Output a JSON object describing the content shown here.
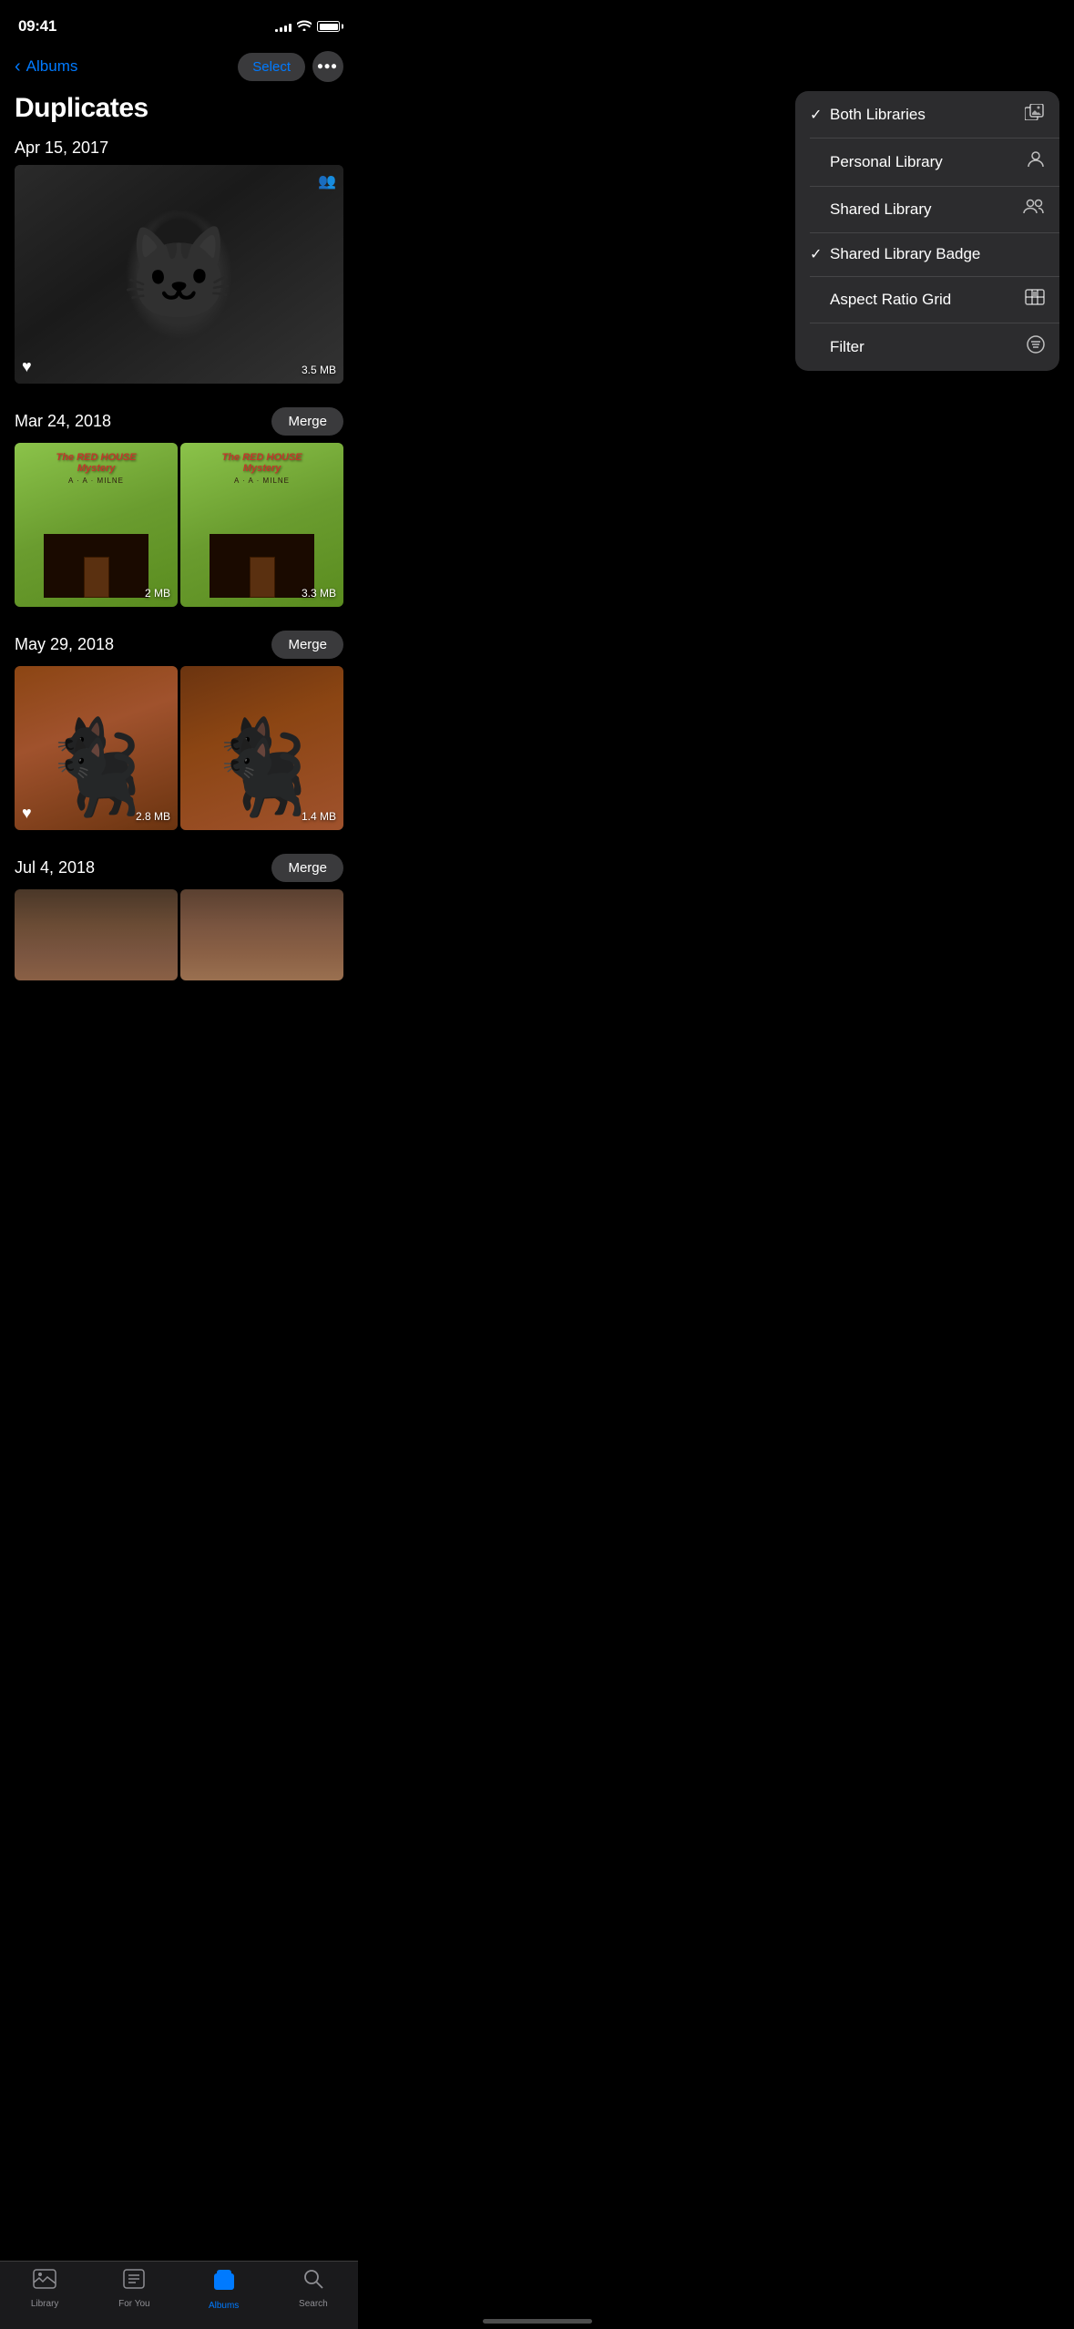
{
  "status": {
    "time": "09:41",
    "signal_bars": [
      3,
      5,
      7,
      9,
      11
    ],
    "wifi": "wifi",
    "battery": "full"
  },
  "header": {
    "back_label": "Albums",
    "title": "Duplicates",
    "select_label": "Select",
    "more_label": "•••"
  },
  "dropdown": {
    "items": [
      {
        "id": "both-libraries",
        "label": "Both Libraries",
        "checked": true,
        "icon": "gallery"
      },
      {
        "id": "personal-library",
        "label": "Personal Library",
        "checked": false,
        "icon": "person"
      },
      {
        "id": "shared-library",
        "label": "Shared Library",
        "checked": false,
        "icon": "people"
      },
      {
        "id": "shared-library-badge",
        "label": "Shared Library Badge",
        "checked": true,
        "icon": ""
      },
      {
        "id": "aspect-ratio-grid",
        "label": "Aspect Ratio Grid",
        "checked": false,
        "icon": "grid"
      },
      {
        "id": "filter",
        "label": "Filter",
        "checked": false,
        "icon": "filter"
      }
    ]
  },
  "groups": [
    {
      "id": "apr-2017",
      "date": "Apr 15, 2017",
      "show_merge": false,
      "photos": [
        {
          "id": "cat-1",
          "size": "3.5 MB",
          "has_heart": true,
          "has_badge": true,
          "type": "cat"
        }
      ]
    },
    {
      "id": "mar-2018",
      "date": "Mar 24, 2018",
      "show_merge": true,
      "merge_label": "Merge",
      "photos": [
        {
          "id": "book-1",
          "size": "2 MB",
          "has_heart": false,
          "has_badge": false,
          "type": "book"
        },
        {
          "id": "book-2",
          "size": "3.3 MB",
          "has_heart": false,
          "has_badge": false,
          "type": "book"
        }
      ]
    },
    {
      "id": "may-2018",
      "date": "May 29, 2018",
      "show_merge": true,
      "merge_label": "Merge",
      "photos": [
        {
          "id": "cat-floor-1",
          "size": "2.8 MB",
          "has_heart": true,
          "has_badge": false,
          "type": "floor-cat"
        },
        {
          "id": "cat-floor-2",
          "size": "1.4 MB",
          "has_heart": false,
          "has_badge": false,
          "type": "floor-cat"
        }
      ]
    },
    {
      "id": "jul-2018",
      "date": "Jul 4, 2018",
      "show_merge": true,
      "merge_label": "Merge",
      "photos": [
        {
          "id": "rock-1",
          "size": "",
          "has_heart": false,
          "has_badge": false,
          "type": "rocks"
        },
        {
          "id": "rock-2",
          "size": "",
          "has_heart": false,
          "has_badge": false,
          "type": "rocks"
        }
      ]
    }
  ],
  "tabs": [
    {
      "id": "library",
      "label": "Library",
      "icon": "📷",
      "active": false
    },
    {
      "id": "for-you",
      "label": "For You",
      "icon": "❤️",
      "active": false
    },
    {
      "id": "albums",
      "label": "Albums",
      "icon": "📁",
      "active": true
    },
    {
      "id": "search",
      "label": "Search",
      "icon": "🔍",
      "active": false
    }
  ]
}
